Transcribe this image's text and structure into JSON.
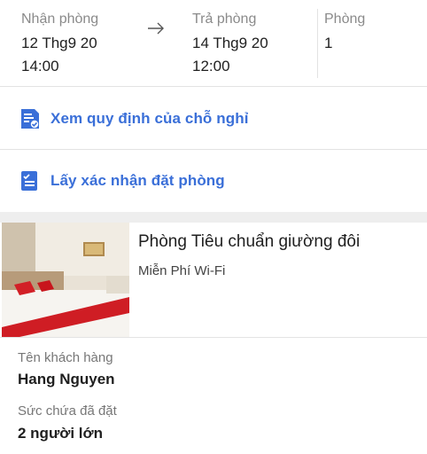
{
  "stay": {
    "checkin": {
      "label": "Nhận phòng",
      "date": "12 Thg9 20",
      "time": "14:00"
    },
    "checkout": {
      "label": "Trả phòng",
      "date": "14 Thg9 20",
      "time": "12:00"
    },
    "rooms": {
      "label": "Phòng",
      "value": "1"
    },
    "arrow_icon": "arrow-right-icon"
  },
  "actions": {
    "policy": {
      "label": "Xem quy định của chỗ nghỉ",
      "icon": "policy-document-icon"
    },
    "confirmation": {
      "label": "Lấy xác nhận đặt phòng",
      "icon": "confirmation-checklist-icon"
    }
  },
  "room": {
    "name": "Phòng Tiêu chuẩn giường đôi",
    "amenity": "Miễn Phí Wi-Fi"
  },
  "guest": {
    "name_label": "Tên khách hàng",
    "name_value": "Hang Nguyen",
    "capacity_label": "Sức chứa đã đặt",
    "capacity_value": "2 người lớn"
  },
  "colors": {
    "accent": "#3a6fd8",
    "divider": "#e3e3e3",
    "section_gap": "#eeeeee"
  }
}
